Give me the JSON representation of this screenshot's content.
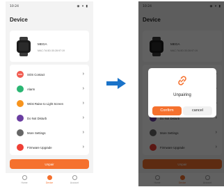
{
  "colors": {
    "accent": "#f5712e",
    "arrow": "#1a73c9"
  },
  "status_bar": {
    "time": "10:24",
    "system_icons": "◉ ▾ ▮"
  },
  "page": {
    "title": "Device"
  },
  "device": {
    "name": "MEGA",
    "mac": "MAC:7A:5D:30:28:97:19"
  },
  "menu": [
    {
      "icon": "sos-icon",
      "icon_text": "SOS",
      "color": "#f15a4f",
      "label": "SOS Contact"
    },
    {
      "icon": "alarm-icon",
      "icon_text": "",
      "color": "#2bb673",
      "label": "Alarm"
    },
    {
      "icon": "wrist-raise-icon",
      "icon_text": "",
      "color": "#f7941d",
      "label": "Wrist Raise to Light Screen"
    },
    {
      "icon": "moon-icon",
      "icon_text": "",
      "color": "#6a3ea1",
      "label": "Do Not Disturb"
    },
    {
      "icon": "more-settings-icon",
      "icon_text": "",
      "color": "#666666",
      "label": "More Settings"
    },
    {
      "icon": "firmware-upgrade-icon",
      "icon_text": "",
      "color": "#ef4036",
      "label": "Firmware Upgrade"
    }
  ],
  "unpair_button": "Unpair",
  "tabs": [
    {
      "label": "Home",
      "active": false
    },
    {
      "label": "Device",
      "active": true
    },
    {
      "label": "Account",
      "active": false
    }
  ],
  "dialog": {
    "icon": "unlink-icon",
    "title": "Unpairing",
    "confirm": "Confirm",
    "cancel": "cancel"
  }
}
